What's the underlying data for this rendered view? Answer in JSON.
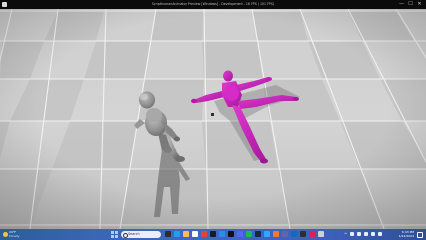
{
  "window": {
    "title": "ScripthumanAnimator Preview [Windows] - Development - 16 FPS ( 101 FPS)",
    "controls": {
      "minimize": "—",
      "maximize": "☐",
      "close": "✕"
    }
  },
  "viewport": {
    "colors": {
      "floor_light": "#d6d6d6",
      "floor_dark": "#bdbdbd",
      "grid_line": "#f4f4f4",
      "mannequin_gray": "#8c8c8c",
      "mannequin_magenta": "#c51fb8"
    }
  },
  "taskbar": {
    "weather": {
      "temp": "24°F",
      "condition": "Cloudy"
    },
    "search": {
      "placeholder": "Search"
    },
    "pinned_icons": [
      {
        "name": "task-view-icon",
        "color": "#2d2d2d"
      },
      {
        "name": "edge-icon",
        "color": "#1fa1e6"
      },
      {
        "name": "file-explorer-icon",
        "color": "#f2c14e"
      },
      {
        "name": "store-icon",
        "color": "#ffffff"
      },
      {
        "name": "chrome-icon",
        "color": "#e94235"
      },
      {
        "name": "terminal-icon",
        "color": "#1b1b1b"
      },
      {
        "name": "vscode-icon",
        "color": "#2a8ee6"
      },
      {
        "name": "unreal-icon",
        "color": "#111111"
      },
      {
        "name": "discord-icon",
        "color": "#5865f2"
      },
      {
        "name": "spotify-icon",
        "color": "#1db954"
      },
      {
        "name": "steam-icon",
        "color": "#1b2838"
      },
      {
        "name": "photoshop-icon",
        "color": "#31a8ff"
      },
      {
        "name": "blender-icon",
        "color": "#f5792a"
      },
      {
        "name": "teams-icon",
        "color": "#6264a7"
      },
      {
        "name": "outlook-icon",
        "color": "#0f6cbd"
      },
      {
        "name": "obs-icon",
        "color": "#2e2e2e"
      },
      {
        "name": "slack-icon",
        "color": "#e01e5a"
      },
      {
        "name": "settings-icon",
        "color": "#d0d0d0"
      }
    ],
    "clock": {
      "time": "6:43 PM",
      "date": "1/22/2024"
    }
  }
}
